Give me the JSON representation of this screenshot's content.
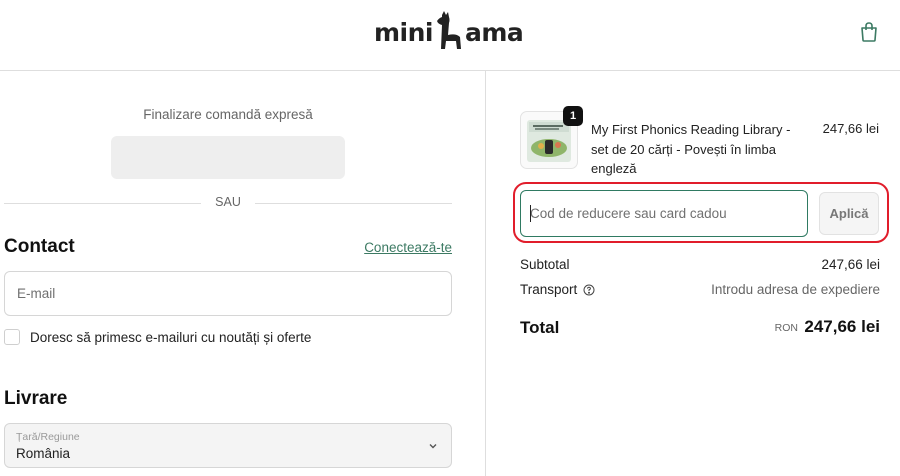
{
  "header": {
    "brand_left": "mini",
    "brand_right": "ama",
    "cart_icon": "shopping-bag-icon"
  },
  "express": {
    "title": "Finalizare comandă expresă",
    "or_label": "SAU"
  },
  "contact": {
    "heading": "Contact",
    "login_link": "Conectează-te",
    "email_placeholder": "E-mail",
    "newsletter_label": "Doresc să primesc e-mailuri cu noutăți și oferte"
  },
  "delivery": {
    "heading": "Livrare",
    "country_label": "Țară/Regiune",
    "country_value": "România",
    "chevron_icon": "chevron-down-icon"
  },
  "order": {
    "item": {
      "quantity": "1",
      "name": "My First Phonics Reading Library - set de 20 cărți - Povești în limba engleză",
      "price": "247,66 lei"
    },
    "discount_placeholder": "Cod de reducere sau card cadou",
    "apply_label": "Aplică",
    "subtotal_label": "Subtotal",
    "subtotal_value": "247,66 lei",
    "shipping_label": "Transport",
    "shipping_value": "Introdu adresa de expediere",
    "help_icon": "question-circle-icon",
    "total_label": "Total",
    "currency": "RON",
    "total_value": "247,66 lei"
  },
  "colors": {
    "accent": "#3c7a63",
    "highlight": "#e11d2b",
    "badge": "#111111"
  }
}
